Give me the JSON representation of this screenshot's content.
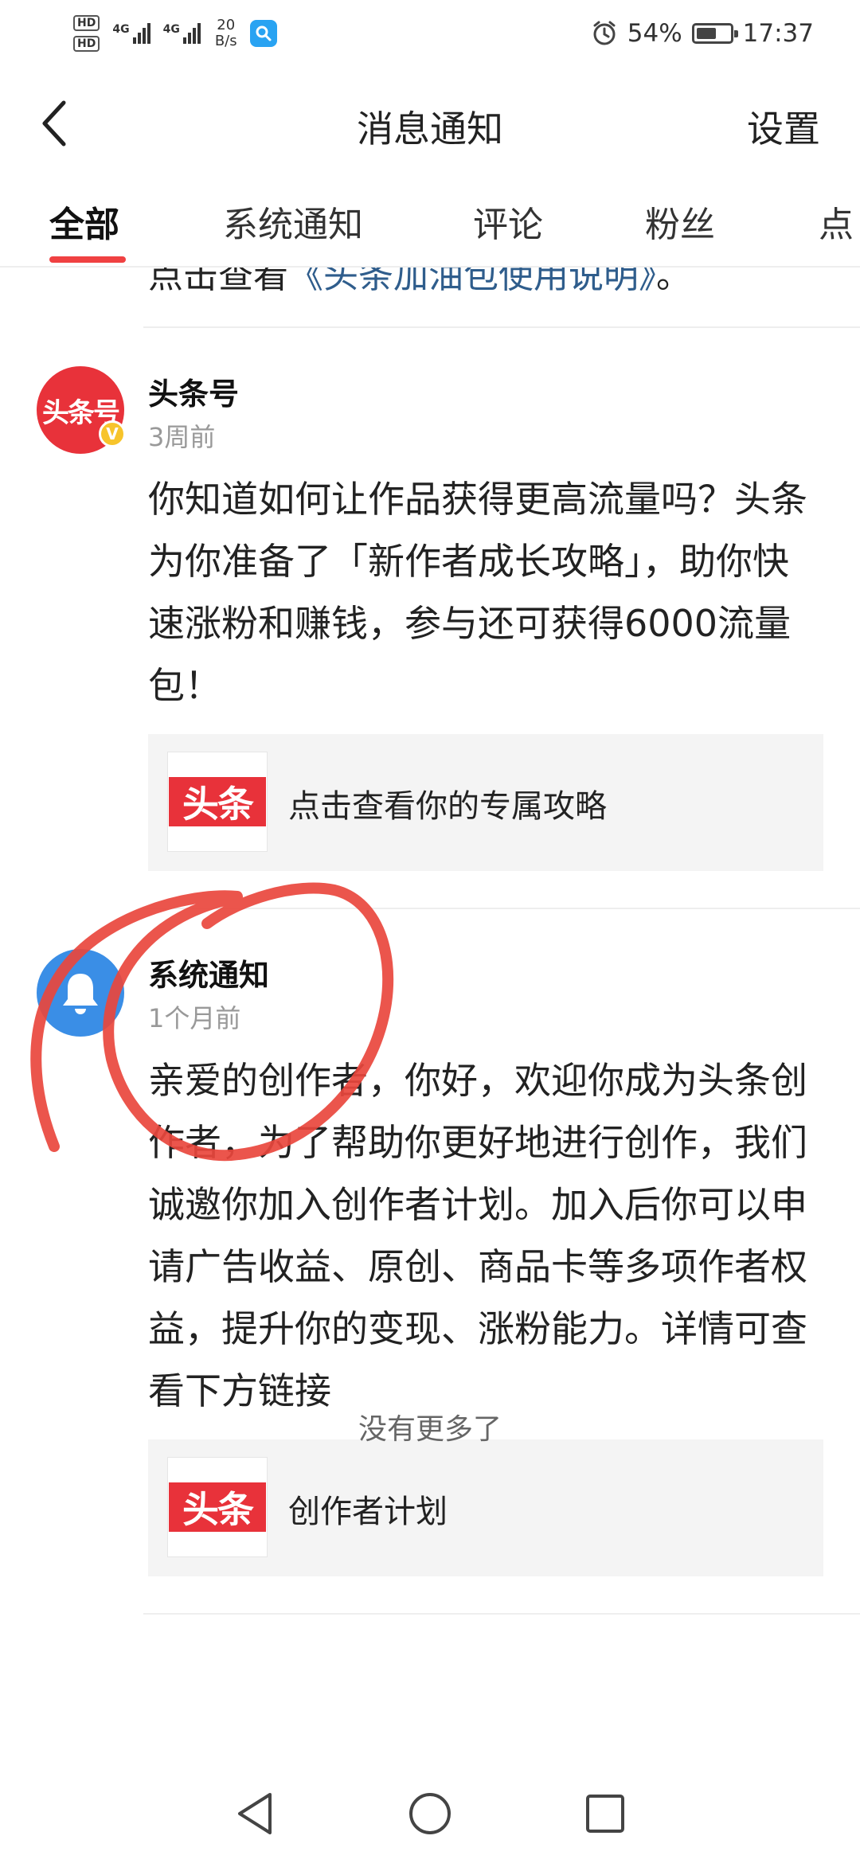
{
  "status_bar": {
    "hd1": "HD",
    "hd2": "HD",
    "net1": "4G",
    "net2": "4G",
    "speed_value": "20",
    "speed_unit": "B/s",
    "battery": "54%",
    "time": "17:37"
  },
  "header": {
    "title": "消息通知",
    "settings_label": "设置"
  },
  "tabs": [
    {
      "label": "全部",
      "active": true
    },
    {
      "label": "系统通知",
      "active": false
    },
    {
      "label": "评论",
      "active": false
    },
    {
      "label": "粉丝",
      "active": false
    },
    {
      "label": "点",
      "active": false
    }
  ],
  "feed": {
    "partial_text_prefix": "点击查看",
    "partial_link": "《头条加油包使用说明》",
    "partial_suffix": "。",
    "messages": [
      {
        "sender": "头条号",
        "avatar_text": "头条号",
        "badge": "V",
        "time": "3周前",
        "body": "你知道如何让作品获得更高流量吗？头条为你准备了「新作者成长攻略」，助你快速涨粉和赚钱，参与还可获得6000流量包！",
        "card_logo": "头条",
        "card_text": "点击查看你的专属攻略"
      },
      {
        "sender": "系统通知",
        "avatar_icon": "bell-icon",
        "time": "1个月前",
        "body": "亲爱的创作者，你好，欢迎你成为头条创作者，为了帮助你更好地进行创作，我们诚邀你加入创作者计划。加入后你可以申请广告收益、原创、商品卡等多项作者权益，提升你的变现、涨粉能力。详情可查看下方链接",
        "card_logo": "头条",
        "card_text": "创作者计划"
      }
    ],
    "no_more": "没有更多了"
  },
  "colors": {
    "accent": "#f04142",
    "brand_red": "#e8323a",
    "system_blue": "#3a8ee6",
    "annotation": "#e9473d"
  }
}
